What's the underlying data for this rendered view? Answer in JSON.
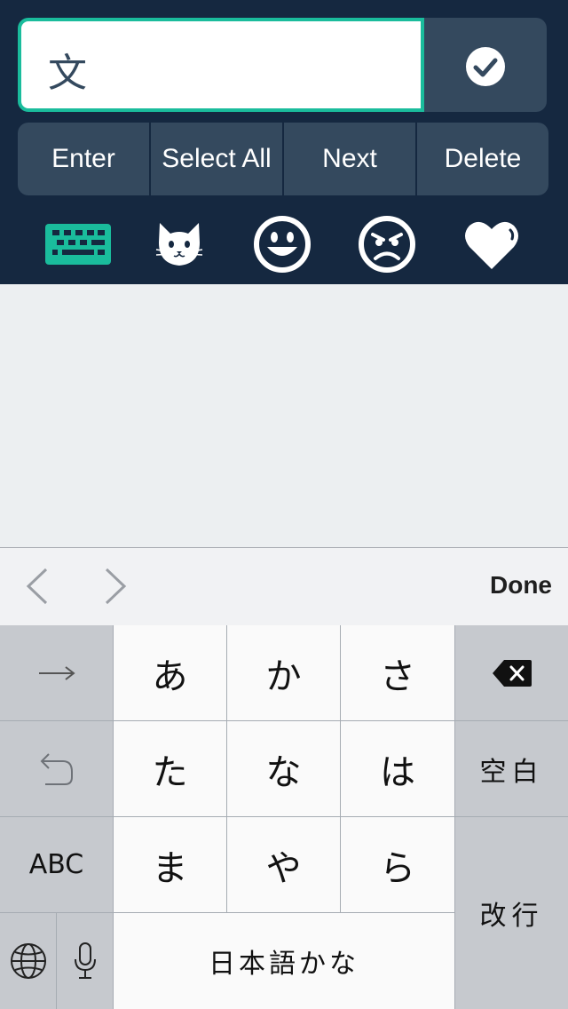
{
  "input": {
    "value": "文"
  },
  "actions": [
    {
      "label": "Enter"
    },
    {
      "label": "Select All"
    },
    {
      "label": "Next"
    },
    {
      "label": "Delete"
    }
  ],
  "categories": [
    {
      "icon": "keyboard-icon",
      "active": true
    },
    {
      "icon": "cat-face-icon"
    },
    {
      "icon": "smile-face-icon"
    },
    {
      "icon": "angry-face-icon"
    },
    {
      "icon": "heart-icon"
    }
  ],
  "accessory": {
    "done_label": "Done"
  },
  "keyboard": {
    "kana": [
      "あ",
      "か",
      "さ",
      "た",
      "な",
      "は",
      "ま",
      "や",
      "ら"
    ],
    "abc_label": "ABC",
    "space_label": "空白",
    "return_label": "改行",
    "mode_label": "日本語かな"
  },
  "colors": {
    "header_bg": "#152840",
    "button_bg": "#34495e",
    "accent": "#1abc9c"
  }
}
